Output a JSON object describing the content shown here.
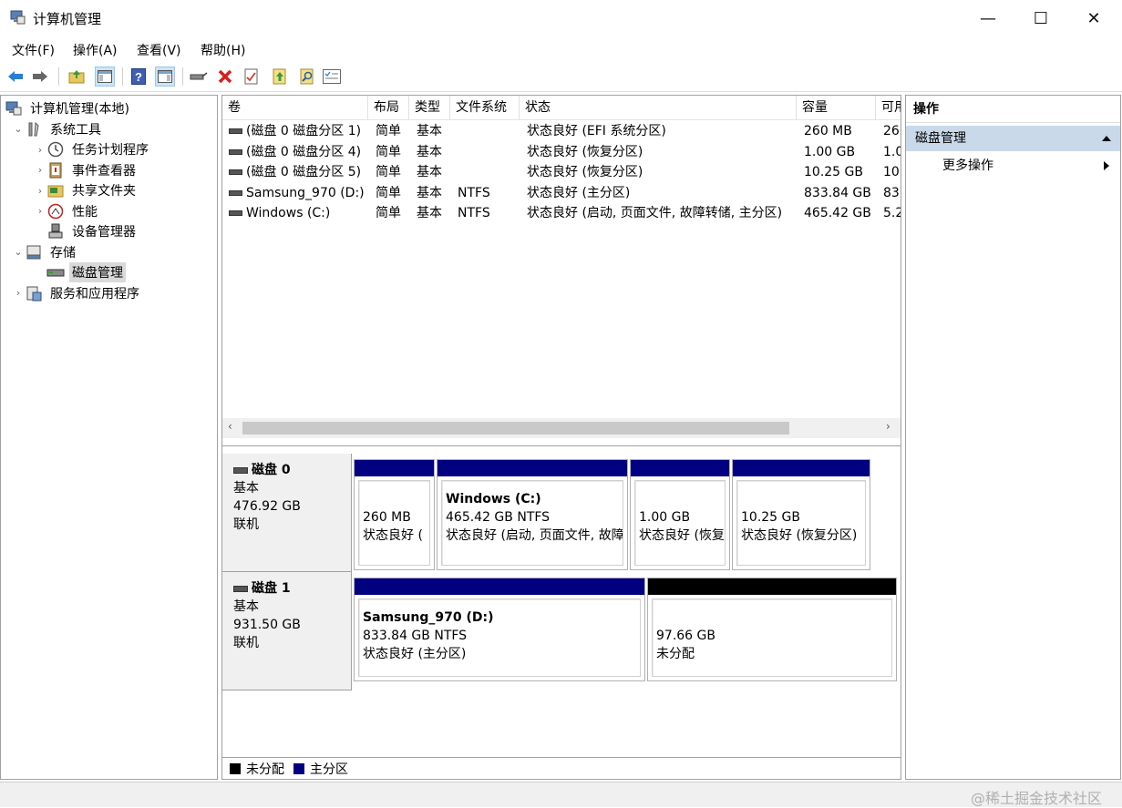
{
  "window": {
    "title": "计算机管理",
    "controls": {
      "minimize": "—",
      "maximize": "☐",
      "close": "✕"
    }
  },
  "menu": [
    "文件(F)",
    "操作(A)",
    "查看(V)",
    "帮助(H)"
  ],
  "toolbar": [
    "back-arrow-icon",
    "forward-arrow-icon",
    "up-folder-icon",
    "show-tree-icon",
    "help-icon",
    "action-pane-icon",
    "connect-icon",
    "delete-icon",
    "properties-icon",
    "import-icon",
    "find-icon",
    "list-icon"
  ],
  "tree": [
    {
      "label": "计算机管理(本地)",
      "icon": "computer-management-icon",
      "level": 0,
      "chevron": ""
    },
    {
      "label": "系统工具",
      "icon": "system-tools-icon",
      "level": 1,
      "chevron": "⌄"
    },
    {
      "label": "任务计划程序",
      "icon": "task-scheduler-icon",
      "level": 2,
      "chevron": "›"
    },
    {
      "label": "事件查看器",
      "icon": "event-viewer-icon",
      "level": 2,
      "chevron": "›"
    },
    {
      "label": "共享文件夹",
      "icon": "shared-folders-icon",
      "level": 2,
      "chevron": "›"
    },
    {
      "label": "性能",
      "icon": "performance-icon",
      "level": 2,
      "chevron": "›"
    },
    {
      "label": "设备管理器",
      "icon": "device-manager-icon",
      "level": 2,
      "chevron": ""
    },
    {
      "label": "存储",
      "icon": "storage-icon",
      "level": 1,
      "chevron": "⌄"
    },
    {
      "label": "磁盘管理",
      "icon": "disk-management-icon",
      "level": 2,
      "chevron": "",
      "selected": true
    },
    {
      "label": "服务和应用程序",
      "icon": "services-apps-icon",
      "level": 1,
      "chevron": "›"
    }
  ],
  "volume_table": {
    "columns": [
      "卷",
      "布局",
      "类型",
      "文件系统",
      "状态",
      "容量",
      "可用"
    ],
    "rows": [
      [
        "(磁盘 0 磁盘分区 1)",
        "简单",
        "基本",
        "",
        "状态良好 (EFI 系统分区)",
        "260 MB",
        "26"
      ],
      [
        "(磁盘 0 磁盘分区 4)",
        "简单",
        "基本",
        "",
        "状态良好 (恢复分区)",
        "1.00 GB",
        "1.0"
      ],
      [
        "(磁盘 0 磁盘分区 5)",
        "简单",
        "基本",
        "",
        "状态良好 (恢复分区)",
        "10.25 GB",
        "10"
      ],
      [
        "Samsung_970 (D:)",
        "简单",
        "基本",
        "NTFS",
        "状态良好 (主分区)",
        "833.84 GB",
        "83"
      ],
      [
        "Windows (C:)",
        "简单",
        "基本",
        "NTFS",
        "状态良好 (启动, 页面文件, 故障转储, 主分区)",
        "465.42 GB",
        "5.2"
      ]
    ]
  },
  "disks": [
    {
      "name": "磁盘 0",
      "type": "基本",
      "size": "476.92 GB",
      "status": "联机",
      "partitions": [
        {
          "name": "",
          "size": "260 MB",
          "status": "状态良好 (",
          "kind": "primary"
        },
        {
          "name": "Windows  (C:)",
          "size": "465.42 GB NTFS",
          "status": "状态良好 (启动, 页面文件, 故障",
          "kind": "primary"
        },
        {
          "name": "",
          "size": "1.00 GB",
          "status": "状态良好 (恢复",
          "kind": "primary"
        },
        {
          "name": "",
          "size": "10.25 GB",
          "status": "状态良好 (恢复分区)",
          "kind": "primary"
        }
      ]
    },
    {
      "name": "磁盘 1",
      "type": "基本",
      "size": "931.50 GB",
      "status": "联机",
      "partitions": [
        {
          "name": "Samsung_970  (D:)",
          "size": "833.84 GB NTFS",
          "status": "状态良好 (主分区)",
          "kind": "primary"
        },
        {
          "name": "",
          "size": "97.66 GB",
          "status": "未分配",
          "kind": "unallocated"
        }
      ]
    }
  ],
  "legend": [
    {
      "label": "未分配",
      "color": "#000000"
    },
    {
      "label": "主分区",
      "color": "#000080"
    }
  ],
  "actions": {
    "header": "操作",
    "section": "磁盘管理",
    "items": [
      "更多操作"
    ]
  },
  "watermark": "@稀土掘金技术社区",
  "colors": {
    "primary_partition": "#000080",
    "unallocated": "#000000",
    "action_section": "#c9d9ea"
  }
}
